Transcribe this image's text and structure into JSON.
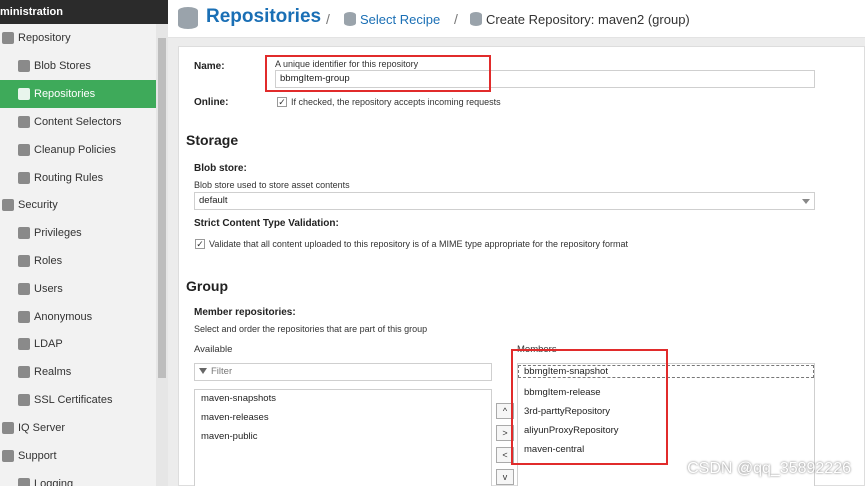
{
  "sidebar": {
    "header": "ministration",
    "items": [
      {
        "label": "Repository",
        "icon": "database-icon",
        "level": 1
      },
      {
        "label": "Blob Stores",
        "icon": "database-icon",
        "level": 2
      },
      {
        "label": "Repositories",
        "icon": "database-icon",
        "level": 2,
        "active": true
      },
      {
        "label": "Content Selectors",
        "icon": "selector-icon",
        "level": 2
      },
      {
        "label": "Cleanup Policies",
        "icon": "broom-icon",
        "level": 2
      },
      {
        "label": "Routing Rules",
        "icon": "routing-icon",
        "level": 2
      },
      {
        "label": "Security",
        "icon": "shield-icon",
        "level": 1
      },
      {
        "label": "Privileges",
        "icon": "medal-icon",
        "level": 2
      },
      {
        "label": "Roles",
        "icon": "role-icon",
        "level": 2
      },
      {
        "label": "Users",
        "icon": "users-icon",
        "level": 2
      },
      {
        "label": "Anonymous",
        "icon": "anonymous-icon",
        "level": 2
      },
      {
        "label": "LDAP",
        "icon": "ldap-icon",
        "level": 2
      },
      {
        "label": "Realms",
        "icon": "realm-icon",
        "level": 2
      },
      {
        "label": "SSL Certificates",
        "icon": "certificate-icon",
        "level": 2
      },
      {
        "label": "IQ Server",
        "icon": "iq-icon",
        "level": 1
      },
      {
        "label": "Support",
        "icon": "support-icon",
        "level": 1
      },
      {
        "label": "Logging",
        "icon": "logging-icon",
        "level": 2
      }
    ]
  },
  "header": {
    "title": "Repositories",
    "crumb1": "Select Recipe",
    "crumb2": "Create Repository: maven2 (group)",
    "separator": "/"
  },
  "form": {
    "name_label": "Name:",
    "name_hint": "A unique identifier for this repository",
    "name_value": "bbmgItem-group",
    "online_label": "Online:",
    "online_checked": true,
    "online_text": "If checked, the repository accepts incoming requests",
    "storage_heading": "Storage",
    "blob_label": "Blob store:",
    "blob_hint": "Blob store used to store asset contents",
    "blob_value": "default",
    "strict_label": "Strict Content Type Validation:",
    "strict_checked": true,
    "strict_text": "Validate that all content uploaded to this repository is of a MIME type appropriate for the repository format",
    "group_heading": "Group",
    "member_label": "Member repositories:",
    "member_hint": "Select and order the repositories that are part of this group",
    "available_label": "Available",
    "filter_placeholder": "Filter",
    "available": [
      "maven-snapshots",
      "maven-releases",
      "maven-public"
    ],
    "members_label": "Members",
    "members": [
      "bbmgItem-snapshot",
      "bbmgItem-release",
      "3rd-parttyRepository",
      "aliyunProxyRepository",
      "maven-central"
    ],
    "arrows": [
      "^",
      ">",
      "<",
      "v"
    ]
  },
  "check_glyph": "✓",
  "highlight_color": "#e12b2b",
  "active_color": "#3eaa5a",
  "watermark": "CSDN @qq_35892226"
}
